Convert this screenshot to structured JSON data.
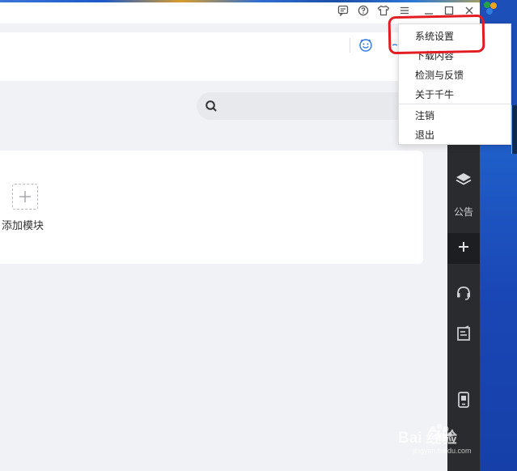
{
  "titlebar": {
    "icons": [
      "feedback-icon",
      "help-icon",
      "skin-icon",
      "menu-icon",
      "minimize-icon",
      "maximize-icon",
      "close-icon"
    ]
  },
  "header": {
    "icons": [
      "smiley-icon"
    ]
  },
  "search": {
    "placeholder": ""
  },
  "module_card": {
    "add_label": "添加模块"
  },
  "sidebar": {
    "items": [
      {
        "icon": "layers-icon",
        "label": "公告"
      },
      {
        "icon": "plus-icon",
        "label": ""
      },
      {
        "icon": "headset-icon",
        "label": ""
      },
      {
        "icon": "note-icon",
        "label": ""
      },
      {
        "icon": "phone-icon",
        "label": ""
      }
    ]
  },
  "menu": {
    "items": [
      "系统设置",
      "下载内容",
      "检测与反馈",
      "关于千牛"
    ],
    "items2": [
      "注销",
      "退出"
    ]
  },
  "watermark": {
    "text": "Bai 经验",
    "url": "jingyan.baidu.com"
  },
  "colors": {
    "annotation_red": "#e31c23",
    "sidebar_dark": "#2a2b2e"
  }
}
